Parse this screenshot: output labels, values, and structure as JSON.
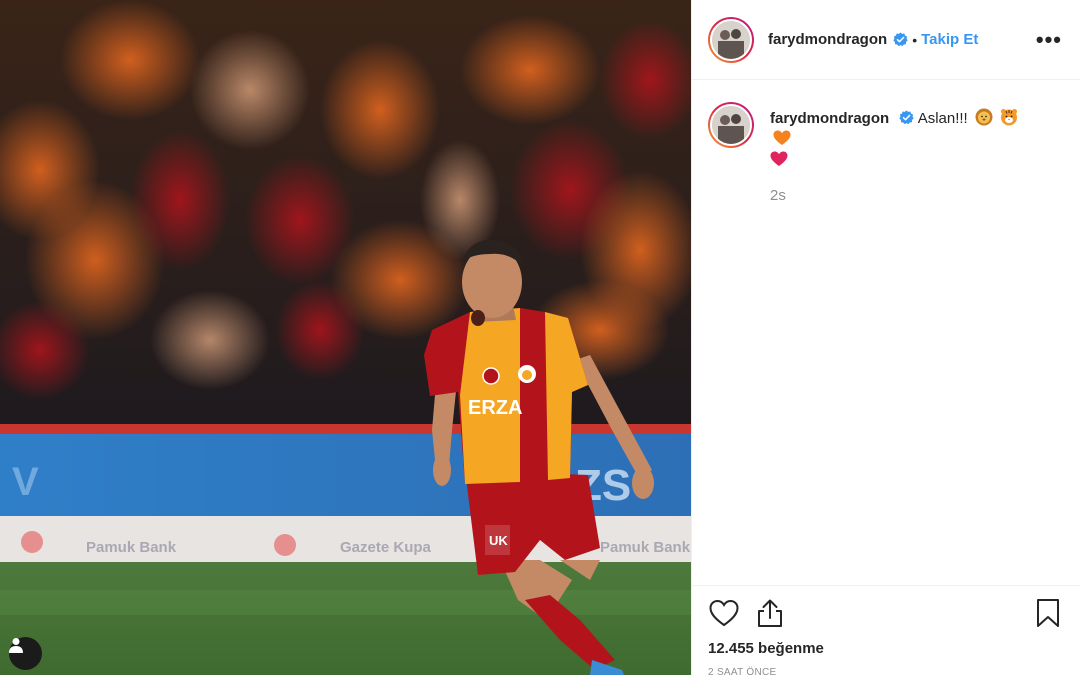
{
  "post": {
    "username": "farydmondragon",
    "separator": "•",
    "follow_label": "Takip Et",
    "more_label": "•••",
    "caption_text": "Aslan!!!",
    "caption_age": "2s",
    "likes_text": "12.455 beğenme",
    "timestamp": "2 SAAT ÖNCE"
  },
  "photo": {
    "shirt_text": "ERZA",
    "shorts_text": "UK",
    "board_texts": [
      "Pamuk Bank",
      "Gazete Kupa",
      "Pamuk Bank"
    ]
  },
  "icons": {
    "verified": "verified-badge-icon",
    "more": "more-options-icon",
    "like": "heart-icon",
    "share": "share-icon",
    "save": "bookmark-icon",
    "tag": "user-tag-icon",
    "emojis": [
      "lion-face-emoji",
      "tiger-face-emoji",
      "orange-heart-emoji",
      "red-heart-emoji"
    ]
  },
  "colors": {
    "link": "#3897f0",
    "verified": "#3897f0",
    "secondary_text": "#8e8e8e",
    "jersey_red": "#b3141c",
    "jersey_yellow": "#f5a623"
  }
}
